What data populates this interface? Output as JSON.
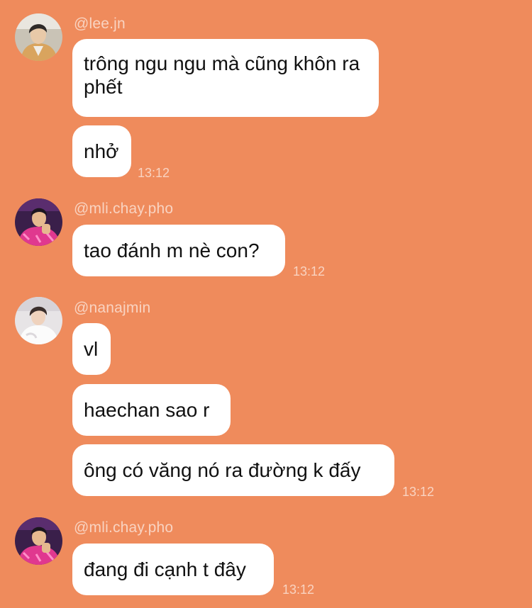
{
  "chat": {
    "groups": [
      {
        "username": "@lee.jn",
        "avatar": "lee-jn-avatar",
        "messages": [
          "trông ngu ngu mà cũng khôn ra phết",
          "nhở"
        ],
        "time": "13:12"
      },
      {
        "username": "@mli.chay.pho",
        "avatar": "mli-chay-pho-avatar",
        "messages": [
          "tao đánh m nè con?"
        ],
        "time": "13:12"
      },
      {
        "username": "@nanajmin",
        "avatar": "nanajmin-avatar",
        "messages": [
          "vl",
          "haechan sao r",
          "ông có văng nó ra đường k đấy"
        ],
        "time": "13:12"
      },
      {
        "username": "@mli.chay.pho",
        "avatar": "mli-chay-pho-avatar",
        "messages": [
          "đang đi cạnh t đây"
        ],
        "time": "13:12"
      }
    ]
  },
  "colors": {
    "background": "#ef8b5c",
    "bubble": "#ffffff",
    "text": "#111111",
    "meta_text": "#fbd0bb"
  }
}
